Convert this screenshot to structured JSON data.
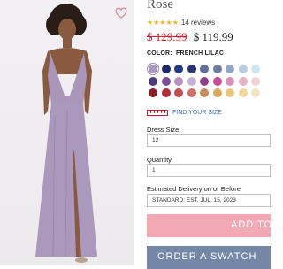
{
  "product": {
    "name": "Rose",
    "rating_stars": "★★★★★",
    "reviews": "14 reviews",
    "old_price": "$ 129.99",
    "new_price": "$ 119.99",
    "color_label": "COLOR:",
    "color_name": "FRENCH LILAC"
  },
  "swatches": [
    [
      "#ab98bd",
      "#1c2a6b",
      "#1f3b86",
      "#2c3570",
      "#5f6f95",
      "#6b7ea3",
      "#8ea6c4",
      "#b8cde0",
      "#cce8ef"
    ],
    [
      "#4d3b7d",
      "#7a4e97",
      "#ba8fc4",
      "#c7b0d4",
      "#8e3e8b",
      "#c94d9a",
      "#d88fb8",
      "#e6b2c7",
      "#f1d0d6"
    ],
    [
      "#8c1f24",
      "#b22d36",
      "#c14e4e",
      "#d07067",
      "#c58c5b",
      "#dcaa5c",
      "#e9c77a",
      "#f0d89e",
      "#f3e5c3"
    ]
  ],
  "selected_swatch": "French Lilac",
  "find_size": "FIND YOUR SIZE",
  "dress_size": {
    "label": "Dress Size",
    "value": "12"
  },
  "quantity": {
    "label": "Quantity",
    "value": "1"
  },
  "delivery": {
    "label": "Estimated Delivery on or Before",
    "value": "STANDARD: EST. JUL. 15, 2023"
  },
  "buttons": {
    "add_to_bag": "ADD TO",
    "order_swatch": "ORDER A SWATCH"
  },
  "colors": {
    "accent_red": "#e2172f",
    "add_button": "#f2a9b3",
    "swatch_button": "#7487a6",
    "star": "#f2b01e"
  }
}
